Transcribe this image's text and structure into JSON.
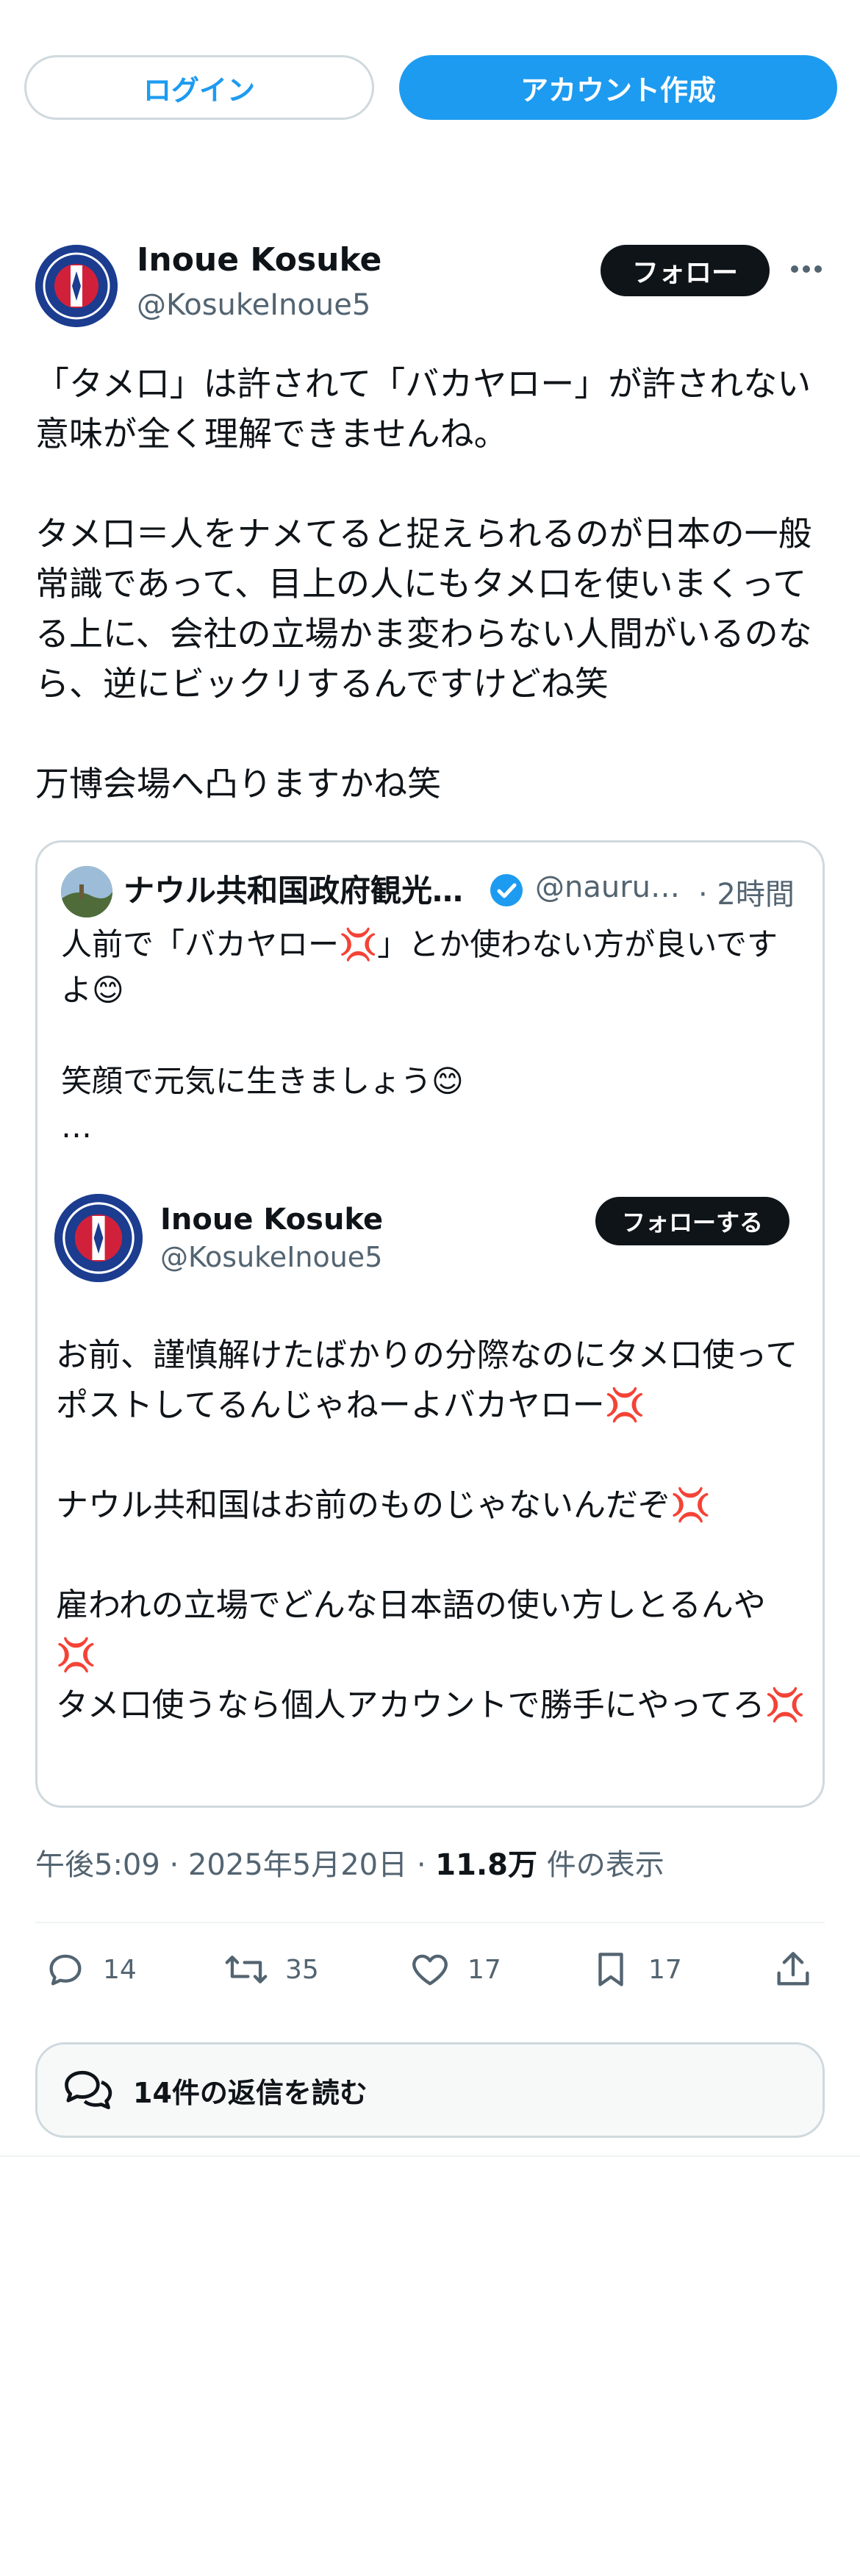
{
  "top_buttons": {
    "login": "ログイン",
    "signup": "アカウント作成"
  },
  "tweet": {
    "author_name": "Inoue Kosuke",
    "author_handle": "@KosukeInoue5",
    "follow_label": "フォロー",
    "more_icon": "more-dots-icon",
    "text": "「タメ口」は許されて「バカヤロー」が許されない意味が全く理解できませんね。\n\nタメ口＝人をナメてると捉えられるのが日本の一般常識であって、目上の人にもタメ口を使いまくってる上に、会社の立場かま変わらない人間がいるのなら、逆にビックリするんですけどね笑\n\n万博会場へ凸りますかね笑",
    "time": "午後5:09",
    "date": "2025年5月20日",
    "views_count": "11.8万",
    "views_label": "件の表示",
    "separator": "·"
  },
  "quote": {
    "author_name": "ナウル共和国政府観光…",
    "author_handle": "@nauru…",
    "time_ago": "· 2時間",
    "text": "人前で「バカヤロー💢」とか使わない方が良いですよ😊\n\n笑顔で元気に生きましょう😊\n…",
    "inner": {
      "author_name": "Inoue Kosuke",
      "author_handle": "@KosukeInoue5",
      "follow_label": "フォローする",
      "text": "お前、謹慎解けたばかりの分際なのにタメ口使ってポストしてるんじゃねーよバカヤロー💢\n\nナウル共和国はお前のものじゃないんだぞ💢\n\n雇われの立場でどんな日本語の使い方しとるんや💢\nタメ口使うなら個人アカウントで勝手にやってろ💢"
    }
  },
  "actions": {
    "reply_count": "14",
    "retweet_count": "35",
    "like_count": "17",
    "bookmark_count": "17"
  },
  "read_replies": "14件の返信を読む",
  "colors": {
    "accent": "#1d9bf0",
    "text": "#0f1419",
    "muted": "#536471",
    "border": "#cfd9de"
  }
}
